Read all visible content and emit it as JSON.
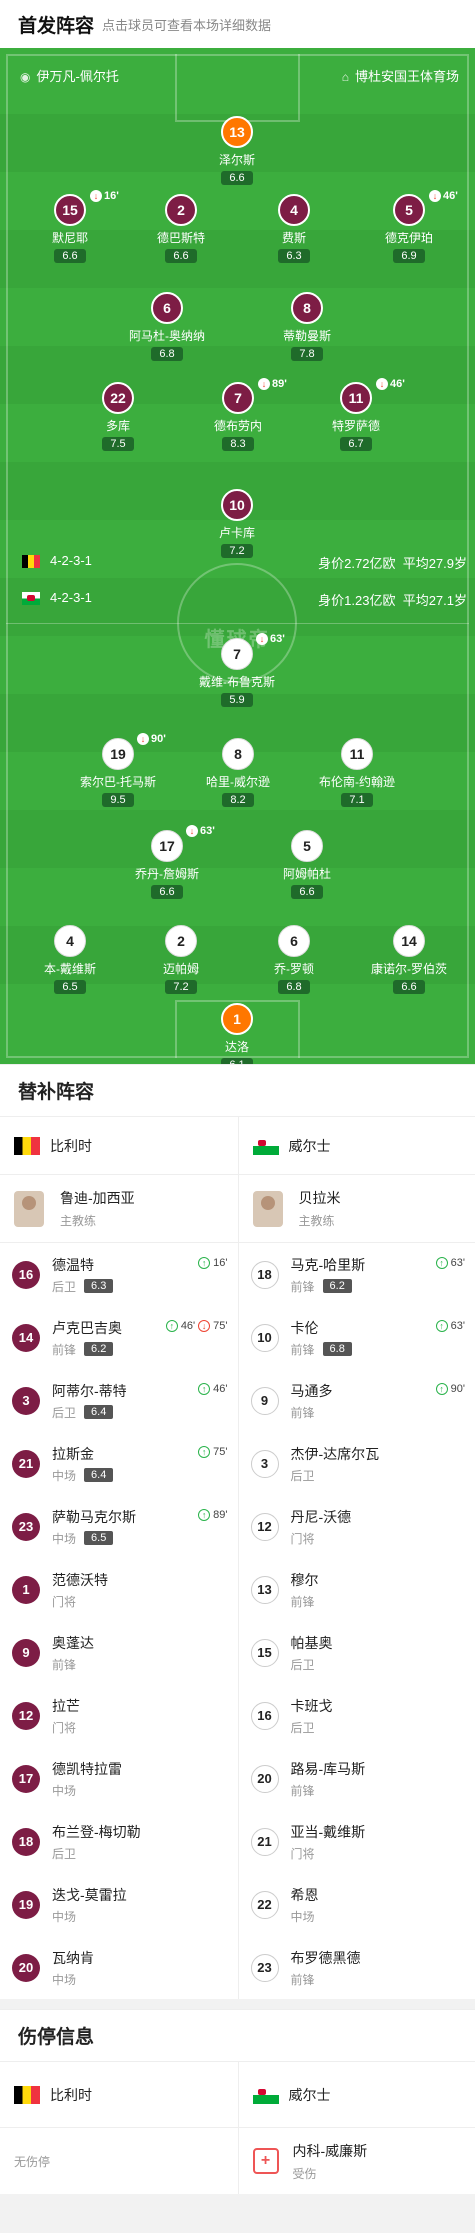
{
  "header": {
    "title": "首发阵容",
    "subtitle": "点击球员可查看本场详细数据"
  },
  "pitch": {
    "coach_label": "伊万凡-佩尔托",
    "stadium_label": "博杜安国王体育场",
    "watermark": "懂球帝",
    "home": {
      "formation": "4-2-3-1",
      "value": "身价2.72亿欧",
      "age": "平均27.9岁"
    },
    "away": {
      "formation": "4-2-3-1",
      "value": "身价1.23亿欧",
      "age": "平均27.1岁"
    }
  },
  "players": [
    {
      "id": "p1",
      "num": "13",
      "name": "泽尔斯",
      "rating": "6.6",
      "team": "gk"
    },
    {
      "id": "p2",
      "num": "15",
      "name": "默尼耶",
      "rating": "6.6",
      "team": "home",
      "ev": "16'"
    },
    {
      "id": "p3",
      "num": "2",
      "name": "德巴斯特",
      "rating": "6.6",
      "team": "home"
    },
    {
      "id": "p4",
      "num": "4",
      "name": "费斯",
      "rating": "6.3",
      "team": "home"
    },
    {
      "id": "p5",
      "num": "5",
      "name": "德克伊珀",
      "rating": "6.9",
      "team": "home",
      "ev": "46'"
    },
    {
      "id": "p6",
      "num": "6",
      "name": "阿马杜-奥纳纳",
      "rating": "6.8",
      "team": "home"
    },
    {
      "id": "p7",
      "num": "8",
      "name": "蒂勒曼斯",
      "rating": "7.8",
      "team": "home"
    },
    {
      "id": "p8",
      "num": "22",
      "name": "多库",
      "rating": "7.5",
      "team": "home"
    },
    {
      "id": "p9",
      "num": "7",
      "name": "德布劳内",
      "rating": "8.3",
      "team": "home",
      "ev": "89'"
    },
    {
      "id": "p10",
      "num": "11",
      "name": "特罗萨德",
      "rating": "6.7",
      "team": "home",
      "ev": "46'"
    },
    {
      "id": "p11",
      "num": "10",
      "name": "卢卡库",
      "rating": "7.2",
      "team": "home"
    },
    {
      "id": "p12",
      "num": "7",
      "name": "戴维-布鲁克斯",
      "rating": "5.9",
      "team": "away",
      "ev": "63'"
    },
    {
      "id": "p13",
      "num": "19",
      "name": "索尔巴-托马斯",
      "rating": "9.5",
      "team": "away",
      "ev": "90'"
    },
    {
      "id": "p14",
      "num": "8",
      "name": "哈里-威尔逊",
      "rating": "8.2",
      "team": "away"
    },
    {
      "id": "p15",
      "num": "11",
      "name": "布伦南-约翰逊",
      "rating": "7.1",
      "team": "away"
    },
    {
      "id": "p16",
      "num": "17",
      "name": "乔丹-詹姆斯",
      "rating": "6.6",
      "team": "away",
      "ev": "63'"
    },
    {
      "id": "p17",
      "num": "5",
      "name": "阿姆帕杜",
      "rating": "6.6",
      "team": "away"
    },
    {
      "id": "p18",
      "num": "4",
      "name": "本-戴维斯",
      "rating": "6.5",
      "team": "away"
    },
    {
      "id": "p19",
      "num": "2",
      "name": "迈帕姆",
      "rating": "7.2",
      "team": "away"
    },
    {
      "id": "p20",
      "num": "6",
      "name": "乔-罗顿",
      "rating": "6.8",
      "team": "away"
    },
    {
      "id": "p21",
      "num": "14",
      "name": "康诺尔-罗伯茨",
      "rating": "6.6",
      "team": "away"
    },
    {
      "id": "p22",
      "num": "1",
      "name": "达洛",
      "rating": "6.1",
      "team": "gk"
    }
  ],
  "subs": {
    "title": "替补阵容",
    "home_team": "比利时",
    "away_team": "威尔士",
    "home_coach": {
      "name": "鲁迪-加西亚",
      "role": "主教练"
    },
    "away_coach": {
      "name": "贝拉米",
      "role": "主教练"
    },
    "home": [
      {
        "num": "16",
        "name": "德温特",
        "pos": "后卫",
        "rating": "6.3",
        "ev": "16'"
      },
      {
        "num": "14",
        "name": "卢克巴吉奥",
        "pos": "前锋",
        "rating": "6.2",
        "ev": "46'",
        "ev2": "75'"
      },
      {
        "num": "3",
        "name": "阿蒂尔-蒂特",
        "pos": "后卫",
        "rating": "6.4",
        "ev": "46'"
      },
      {
        "num": "21",
        "name": "拉斯金",
        "pos": "中场",
        "rating": "6.4",
        "ev": "75'"
      },
      {
        "num": "23",
        "name": "萨勒马克尔斯",
        "pos": "中场",
        "rating": "6.5",
        "ev": "89'"
      },
      {
        "num": "1",
        "name": "范德沃特",
        "pos": "门将"
      },
      {
        "num": "9",
        "name": "奥蓬达",
        "pos": "前锋"
      },
      {
        "num": "12",
        "name": "拉芒",
        "pos": "门将"
      },
      {
        "num": "17",
        "name": "德凯特拉雷",
        "pos": "中场"
      },
      {
        "num": "18",
        "name": "布兰登-梅切勒",
        "pos": "后卫"
      },
      {
        "num": "19",
        "name": "迭戈-莫雷拉",
        "pos": "中场"
      },
      {
        "num": "20",
        "name": "瓦纳肯",
        "pos": "中场"
      }
    ],
    "away": [
      {
        "num": "18",
        "name": "马克-哈里斯",
        "pos": "前锋",
        "rating": "6.2",
        "ev": "63'"
      },
      {
        "num": "10",
        "name": "卡伦",
        "pos": "前锋",
        "rating": "6.8",
        "ev": "63'"
      },
      {
        "num": "9",
        "name": "马通多",
        "pos": "前锋",
        "ev": "90'"
      },
      {
        "num": "3",
        "name": "杰伊-达席尔瓦",
        "pos": "后卫"
      },
      {
        "num": "12",
        "name": "丹尼-沃德",
        "pos": "门将"
      },
      {
        "num": "13",
        "name": "穆尔",
        "pos": "前锋"
      },
      {
        "num": "15",
        "name": "帕基奥",
        "pos": "后卫"
      },
      {
        "num": "16",
        "name": "卡班戈",
        "pos": "后卫"
      },
      {
        "num": "20",
        "name": "路易-库马斯",
        "pos": "前锋"
      },
      {
        "num": "21",
        "name": "亚当-戴维斯",
        "pos": "门将"
      },
      {
        "num": "22",
        "name": "希恩",
        "pos": "中场"
      },
      {
        "num": "23",
        "name": "布罗德黑德",
        "pos": "前锋"
      }
    ]
  },
  "injury": {
    "title": "伤停信息",
    "home_team": "比利时",
    "away_team": "威尔士",
    "home_none": "无伤停",
    "away_player": {
      "name": "内科-威廉斯",
      "status": "受伤"
    }
  }
}
